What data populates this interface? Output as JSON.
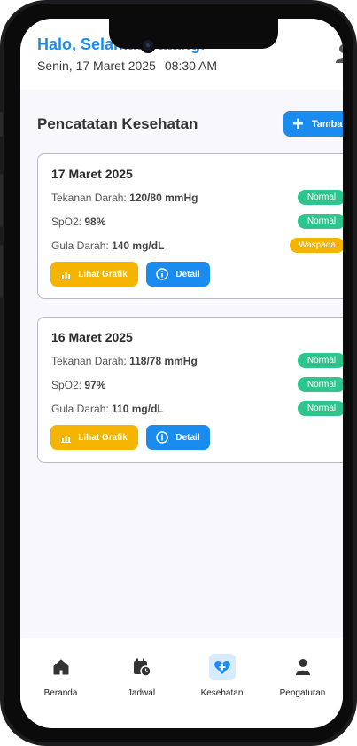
{
  "header": {
    "greeting": "Halo, Selamat Datang!",
    "date": "Senin, 17 Maret 2025",
    "time": "08:30 AM"
  },
  "section": {
    "title": "Pencatatan Kesehatan",
    "add_label": "Tamba"
  },
  "records": [
    {
      "date": "17 Maret 2025",
      "metrics": [
        {
          "label": "Tekanan Darah:",
          "value": "120/80 mmHg",
          "status": "Normal",
          "status_type": "normal"
        },
        {
          "label": "SpO2:",
          "value": "98%",
          "status": "Normal",
          "status_type": "normal"
        },
        {
          "label": "Gula Darah:",
          "value": "140 mg/dL",
          "status": "Waspada",
          "status_type": "warn"
        }
      ],
      "buttons": {
        "chart": "Lihat Grafik",
        "detail": "Detail"
      }
    },
    {
      "date": "16 Maret 2025",
      "metrics": [
        {
          "label": "Tekanan Darah:",
          "value": "118/78 mmHg",
          "status": "Normal",
          "status_type": "normal"
        },
        {
          "label": "SpO2:",
          "value": "97%",
          "status": "Normal",
          "status_type": "normal"
        },
        {
          "label": "Gula Darah:",
          "value": "110 mg/dL",
          "status": "Normal",
          "status_type": "normal"
        }
      ],
      "buttons": {
        "chart": "Lihat Grafik",
        "detail": "Detail"
      }
    }
  ],
  "nav": {
    "items": [
      {
        "label": "Beranda",
        "icon": "home-icon",
        "active": false
      },
      {
        "label": "Jadwal",
        "icon": "calendar-clock-icon",
        "active": false
      },
      {
        "label": "Kesehatan",
        "icon": "heart-plus-icon",
        "active": true
      },
      {
        "label": "Pengaturan",
        "icon": "person-icon",
        "active": false
      }
    ]
  },
  "colors": {
    "primary": "#1a8cf0",
    "success": "#2ec58c",
    "warning": "#f5b400",
    "background": "#f7f7fc"
  }
}
